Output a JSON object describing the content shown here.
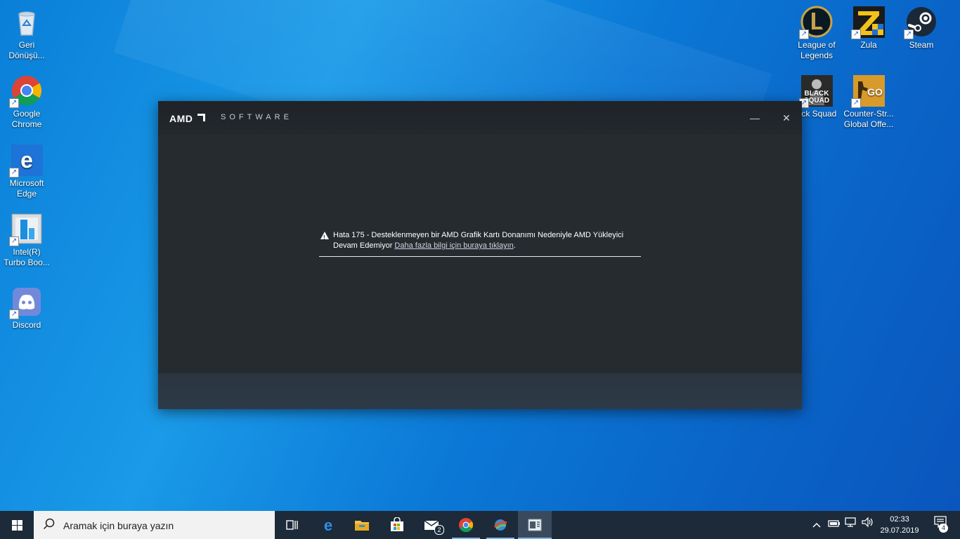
{
  "desktop": {
    "left_icons": [
      {
        "label": "Geri\nDönüşü...",
        "icon": "recycle-bin-icon"
      },
      {
        "label": "Google\nChrome",
        "icon": "chrome-icon"
      },
      {
        "label": "Microsoft\nEdge",
        "icon": "edge-icon"
      },
      {
        "label": "Intel(R)\nTurbo Boo...",
        "icon": "intel-turbo-boost-icon"
      },
      {
        "label": "Discord",
        "icon": "discord-icon"
      }
    ],
    "right_icons": [
      {
        "label": "League of\nLegends",
        "icon": "league-of-legends-icon"
      },
      {
        "label": "Zula",
        "icon": "zula-icon"
      },
      {
        "label": "Steam",
        "icon": "steam-icon"
      },
      {
        "label": "ack Squad",
        "icon": "black-squad-icon",
        "art_text": "BLACK\nSQUAD"
      },
      {
        "label": "Counter-Str...\nGlobal Offe...",
        "icon": "csgo-icon",
        "art_text": "GO"
      }
    ]
  },
  "window": {
    "brand": "AMD",
    "title": "SOFTWARE",
    "minimize_glyph": "—",
    "close_glyph": "✕",
    "error_text": "Hata 175 - Desteklenmeyen bir AMD Grafik Kartı Donanımı Nedeniyle AMD Yükleyici Devam Edemiyor",
    "link_text": "Daha fazla bilgi için buraya tıklayın",
    "link_suffix": "."
  },
  "taskbar": {
    "search_placeholder": "Aramak için buraya yazın",
    "apps": [
      "task-view-icon",
      "edge-icon",
      "file-explorer-icon",
      "store-icon",
      "mail-icon",
      "chrome-icon",
      "installer-icon",
      "amd-installer-icon"
    ],
    "mail_badge": "2",
    "clock_time": "02:33",
    "clock_date": "29.07.2019",
    "notification_count": "4",
    "colors": {
      "bar": "#1c2a3a",
      "accent": "#7fb6ea"
    }
  },
  "colors": {
    "window_bg": "#262b30",
    "footer_bg": "#2d3a47",
    "desktop_blue": "#0a7fd8"
  }
}
